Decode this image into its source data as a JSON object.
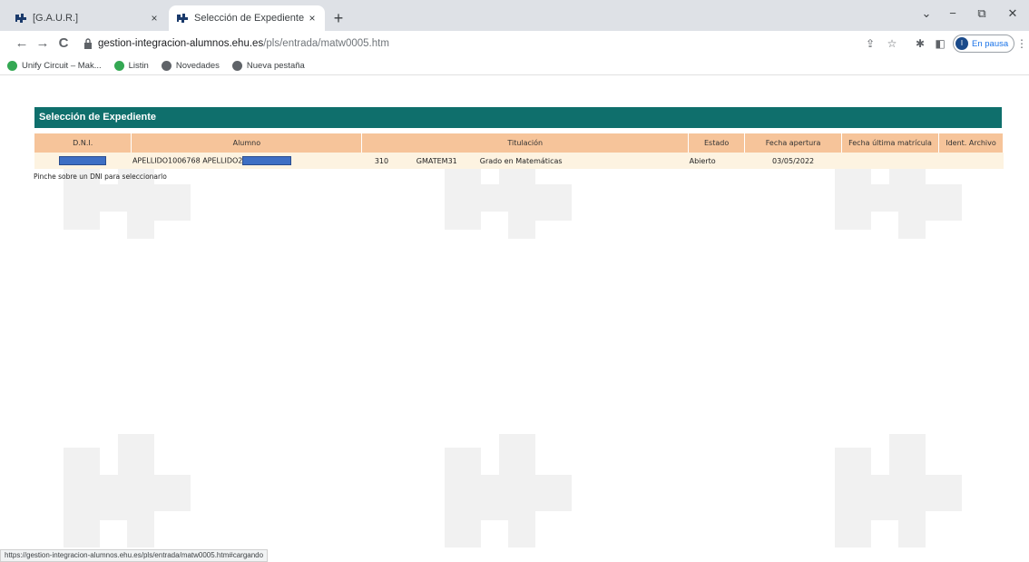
{
  "tabs": [
    {
      "title": "[G.A.U.R.]",
      "close": "×"
    },
    {
      "title": "Selección de Expediente",
      "close": "×"
    }
  ],
  "newtab": "+",
  "window_controls": {
    "menu": "⌄",
    "minimize": "−",
    "restore": "⧉",
    "close": "✕"
  },
  "toolbar": {
    "back": "←",
    "forward": "→",
    "reload": "C",
    "url_host": "gestion-integracion-alumnos.ehu.es",
    "url_path": "/pls/entrada/matw0005.htm",
    "profile_initial": "I",
    "profile_label": "En pausa"
  },
  "bookmarks": [
    {
      "label": "Unify Circuit – Mak...",
      "color": "#34a853"
    },
    {
      "label": "Listin",
      "color": "#34a853"
    },
    {
      "label": "Novedades",
      "color": "#5f6368"
    },
    {
      "label": "Nueva pestaña",
      "color": "#5f6368"
    }
  ],
  "page": {
    "panel_title": "Selección de Expediente",
    "columns": [
      "D.N.I.",
      "Alumno",
      "Titulación",
      "Estado",
      "Fecha apertura",
      "Fecha última matrícula",
      "Ident. Archivo"
    ],
    "row": {
      "alumno": "APELLIDO1006768 APELLIDO2",
      "tit_code": "310",
      "tit_plan": "GMATEM31",
      "tit_name": "Grado en Matemáticas",
      "estado": "Abierto",
      "fecha_apertura": "03/05/2022",
      "fecha_ultima": "",
      "ident_archivo": ""
    },
    "hint": "Pinche sobre un DNI para seleccionarlo"
  },
  "statusbar": "https://gestion-integracion-alumnos.ehu.es/pls/entrada/matw0005.htm#cargando",
  "colors": {
    "header": "#0f6f6c",
    "th": "#f6c49a",
    "td": "#fdf3e1",
    "redaction": "#3e6fc4"
  }
}
